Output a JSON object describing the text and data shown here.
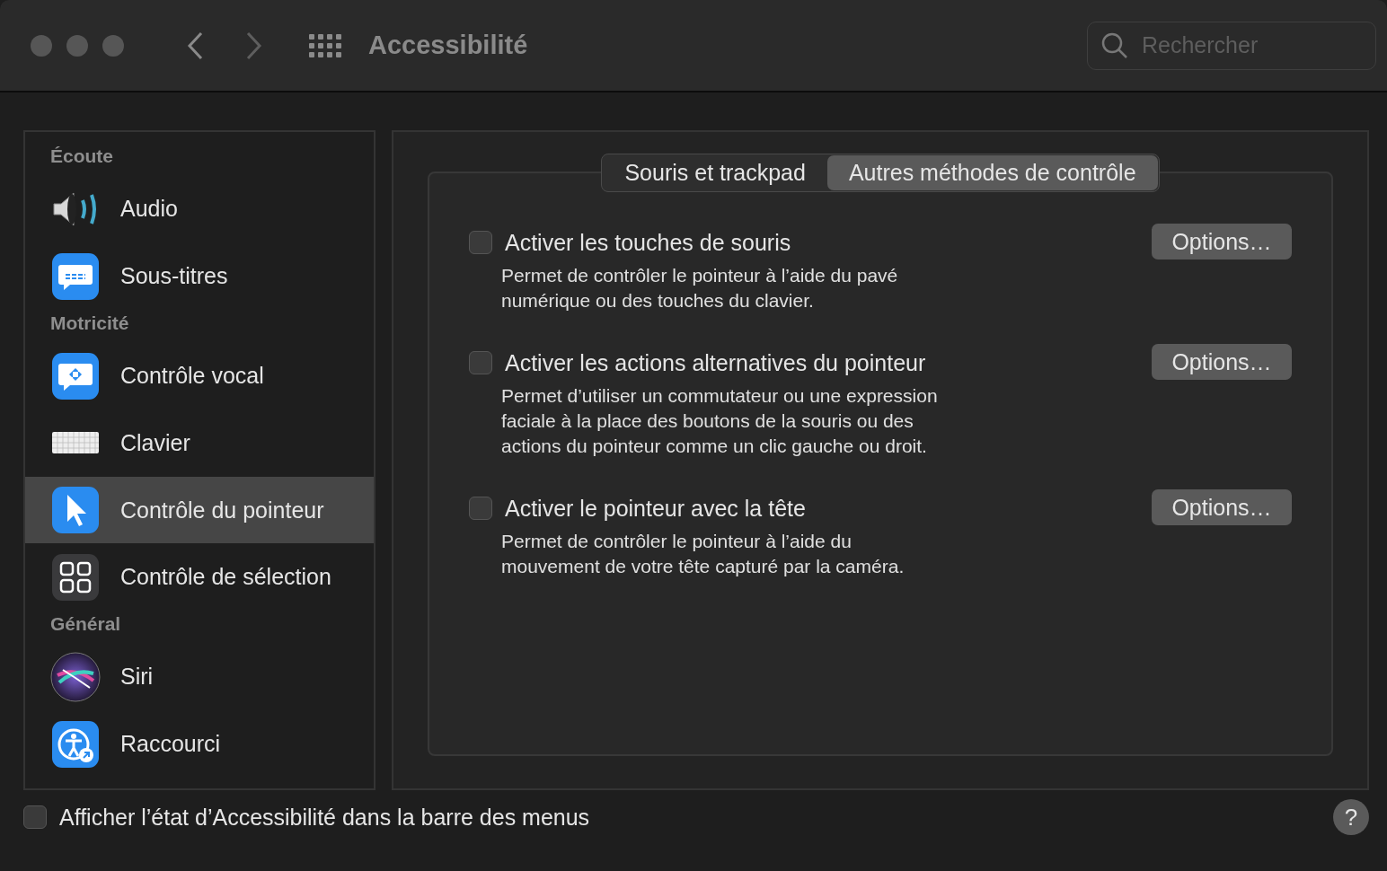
{
  "window": {
    "title": "Accessibilité"
  },
  "search": {
    "placeholder": "Rechercher"
  },
  "sidebar": {
    "groups": [
      {
        "header": "Écoute",
        "items": [
          {
            "label": "Audio",
            "kind": "audio",
            "selected": false
          },
          {
            "label": "Sous-titres",
            "kind": "captions",
            "selected": false
          }
        ]
      },
      {
        "header": "Motricité",
        "items": [
          {
            "label": "Contrôle vocal",
            "kind": "voice",
            "selected": false
          },
          {
            "label": "Clavier",
            "kind": "keyboard",
            "selected": false
          },
          {
            "label": "Contrôle du pointeur",
            "kind": "pointer",
            "selected": true
          },
          {
            "label": "Contrôle de sélection",
            "kind": "switch",
            "selected": false
          }
        ]
      },
      {
        "header": "Général",
        "items": [
          {
            "label": "Siri",
            "kind": "siri",
            "selected": false
          },
          {
            "label": "Raccourci",
            "kind": "shortcut",
            "selected": false
          }
        ]
      }
    ]
  },
  "tabs": [
    {
      "label": "Souris et trackpad",
      "selected": false
    },
    {
      "label": "Autres méthodes de contrôle",
      "selected": true
    }
  ],
  "options": [
    {
      "label": "Activer les touches de souris",
      "checked": false,
      "description": "Permet de contrôler le pointeur à l’aide du pavé\nnumérique ou des touches du clavier.",
      "button": "Options…"
    },
    {
      "label": "Activer les actions alternatives du pointeur",
      "checked": false,
      "description": "Permet d’utiliser un commutateur ou une expression\nfaciale à la place des boutons de la souris ou des\nactions du pointeur comme un clic gauche ou droit.",
      "button": "Options…"
    },
    {
      "label": "Activer le pointeur avec la tête",
      "checked": false,
      "description": "Permet de contrôler le pointeur à l’aide du\nmouvement de votre tête capturé par la caméra.",
      "button": "Options…"
    }
  ],
  "footer": {
    "label": "Afficher l’état d’Accessibilité dans la barre des menus",
    "checked": false,
    "help": "?"
  }
}
